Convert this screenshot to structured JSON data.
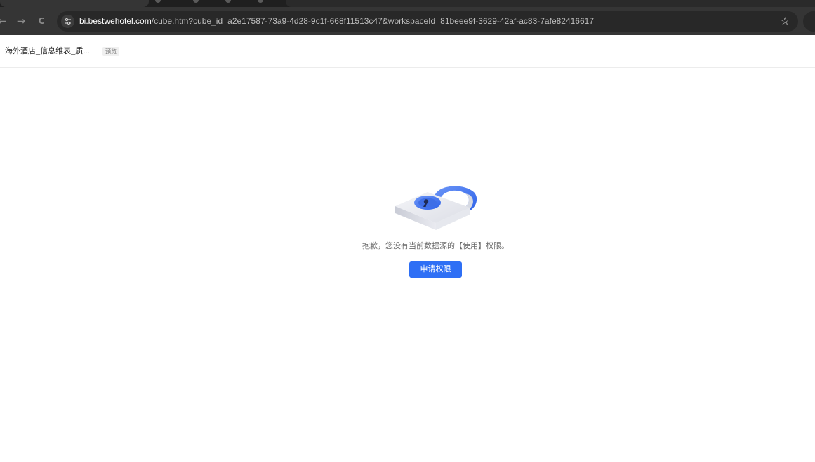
{
  "browser": {
    "url_host": "bi.bestwehotel.com",
    "url_rest": "/cube.htm?cube_id=a2e17587-73a9-4d28-9c1f-668f11513c47&workspaceId=81beee9f-3629-42af-ac83-7afe82416617",
    "back_icon": "←",
    "forward_icon": "→",
    "reload_icon": "C",
    "star_icon": "☆"
  },
  "header": {
    "doc_title": "海外酒店_信息维表_质...",
    "preview_tag": "预览"
  },
  "main": {
    "message": "抱歉，您没有当前数据源的【使用】权限。",
    "apply_button": "申请权限"
  },
  "colors": {
    "accent": "#2e6ff5",
    "toolbar": "#353535",
    "omnibox": "#282828"
  }
}
